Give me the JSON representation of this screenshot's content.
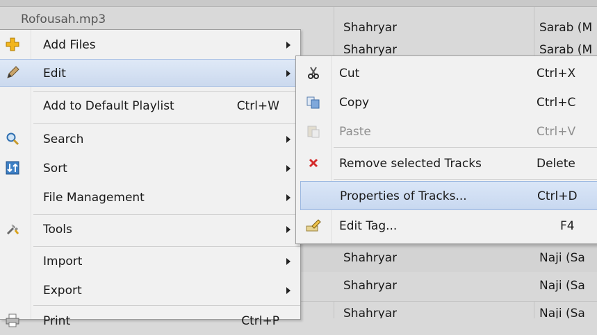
{
  "background_rows": [
    {
      "title": "Rofousah.mp3",
      "artist": "Shahryar",
      "album": "Sarab (M"
    },
    {
      "title": "",
      "artist": "Shahryar",
      "album": "Sarab (M"
    },
    {
      "title": "",
      "artist": "Shahryar",
      "album": "Naji (Sa"
    },
    {
      "title": "",
      "artist": "Shahryar",
      "album": "Naji (Sa"
    },
    {
      "title": "",
      "artist": "Shahryar",
      "album": "Naji (Sa"
    }
  ],
  "main_menu": {
    "items": [
      {
        "label": "Add Files",
        "icon": "plus-icon",
        "has_submenu": true
      },
      {
        "label": "Edit",
        "icon": "pencil-icon",
        "has_submenu": true,
        "active": true
      },
      {
        "label": "Add to Default Playlist",
        "shortcut": "Ctrl+W"
      },
      {
        "label": "Search",
        "icon": "search-icon",
        "has_submenu": true
      },
      {
        "label": "Sort",
        "icon": "sort-icon",
        "has_submenu": true
      },
      {
        "label": "File Management",
        "has_submenu": true
      },
      {
        "label": "Tools",
        "icon": "tools-icon",
        "has_submenu": true
      },
      {
        "label": "Import",
        "has_submenu": true
      },
      {
        "label": "Export",
        "has_submenu": true
      },
      {
        "label": "Print",
        "icon": "printer-icon",
        "shortcut": "Ctrl+P"
      }
    ]
  },
  "edit_submenu": {
    "items": [
      {
        "label": "Cut",
        "shortcut": "Ctrl+X",
        "icon": "scissors-icon"
      },
      {
        "label": "Copy",
        "shortcut": "Ctrl+C",
        "icon": "copy-icon"
      },
      {
        "label": "Paste",
        "shortcut": "Ctrl+V",
        "icon": "paste-icon",
        "disabled": true
      },
      {
        "label": "Remove selected Tracks",
        "shortcut": "Delete",
        "icon": "remove-icon"
      },
      {
        "label": "Properties of Tracks...",
        "shortcut": "Ctrl+D",
        "highlighted": true
      },
      {
        "label": "Edit Tag...",
        "shortcut": "F4",
        "icon": "edit-tag-icon"
      }
    ]
  },
  "colors": {
    "menu_bg": "#f1f1f1",
    "highlight": "#cbd9ee",
    "remove_red": "#d42a2a",
    "plus_yellow": "#f2b51c"
  }
}
